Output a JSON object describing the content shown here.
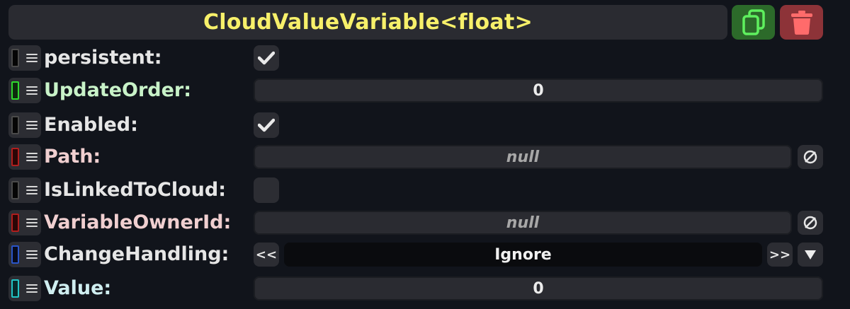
{
  "header": {
    "title": "CloudValueVariable<float>",
    "copy_icon": "copy-icon",
    "delete_icon": "trash-icon"
  },
  "fields": [
    {
      "label": "persistent:",
      "label_color": "#e6e6e6",
      "swatch": "#050505",
      "swatch_border": "#4a4a4a",
      "kind": "checkbox",
      "checked": true
    },
    {
      "label": "UpdateOrder:",
      "label_color": "#c8f2c8",
      "swatch": "#0d2a0d",
      "swatch_border": "#2fd92f",
      "kind": "number",
      "value": "0"
    },
    {
      "label": "Enabled:",
      "label_color": "#e6e6e6",
      "swatch": "#050505",
      "swatch_border": "#4a4a4a",
      "kind": "checkbox",
      "checked": true
    },
    {
      "label": "Path:",
      "label_color": "#f0cfd0",
      "swatch": "#2a0606",
      "swatch_border": "#b01e1e",
      "kind": "reference",
      "value": "null"
    },
    {
      "label": "IsLinkedToCloud:",
      "label_color": "#e6e6e6",
      "swatch": "#050505",
      "swatch_border": "#4a4a4a",
      "kind": "checkbox",
      "checked": false
    },
    {
      "label": "VariableOwnerId:",
      "label_color": "#f0cfd0",
      "swatch": "#2a0606",
      "swatch_border": "#b01e1e",
      "kind": "reference",
      "value": "null"
    },
    {
      "label": "ChangeHandling:",
      "label_color": "#e6e6e6",
      "swatch": "#060a1c",
      "swatch_border": "#2a55c8",
      "kind": "enum",
      "value": "Ignore",
      "prev_label": "<<",
      "next_label": ">>"
    },
    {
      "label": "Value:",
      "label_color": "#cfeef0",
      "swatch": "#072a2a",
      "swatch_border": "#22c6c6",
      "kind": "number",
      "value": "0"
    }
  ],
  "icons": {
    "null": "null-icon",
    "dropdown": "dropdown-arrow-icon",
    "check": "check-icon",
    "grip": "grip-icon"
  }
}
